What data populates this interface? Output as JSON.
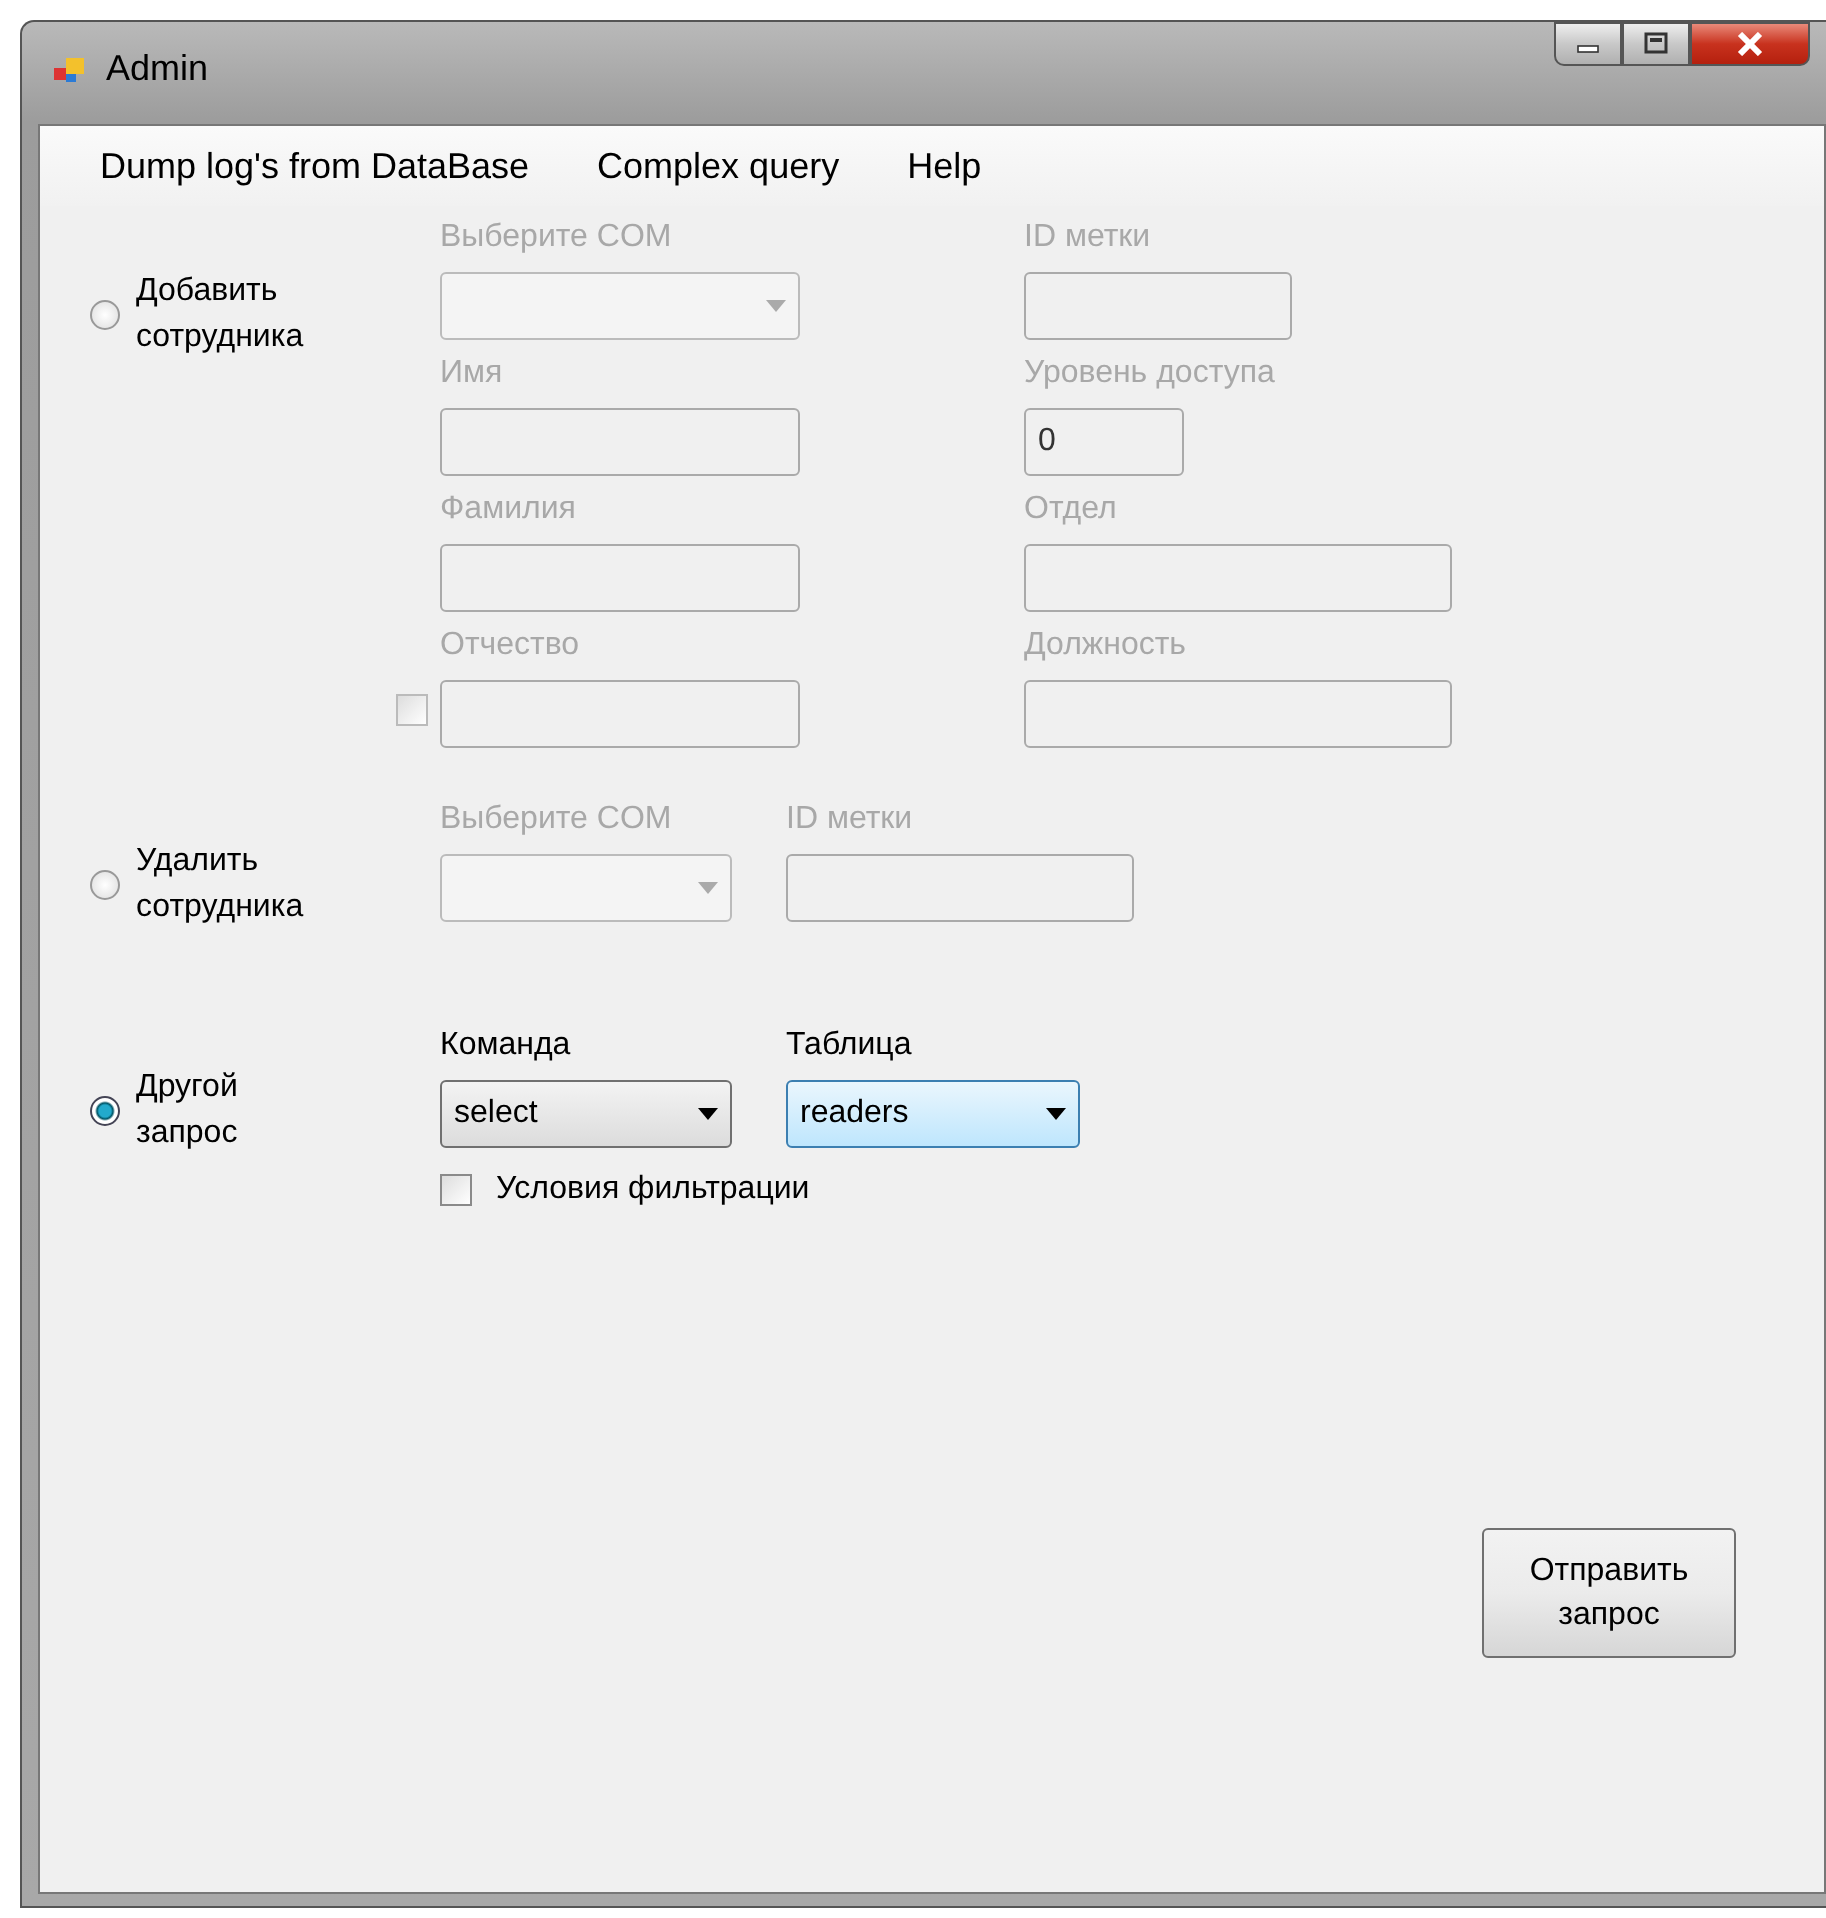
{
  "window": {
    "title": "Admin"
  },
  "menu": [
    {
      "label": "Dump log's from DataBase"
    },
    {
      "label": "Complex query"
    },
    {
      "label": "Help"
    }
  ],
  "sections": [
    {
      "kind": "add",
      "label": "Добавить сотрудника",
      "selected": false,
      "enabled": false,
      "checkbox": {
        "checked": false
      },
      "fields": [
        {
          "kind": "combo",
          "label": "Выберите COM"
        },
        {
          "kind": "text",
          "label": "ID метки"
        },
        {
          "kind": "text",
          "label": "Имя"
        },
        {
          "kind": "number",
          "label": "Уровень доступа",
          "value": "0"
        },
        {
          "kind": "text",
          "label": "Фамилия"
        },
        {
          "kind": "text",
          "label": "Отдел"
        },
        {
          "kind": "text",
          "label": "Отчество"
        },
        {
          "kind": "text",
          "label": "Должность"
        }
      ]
    },
    {
      "kind": "delete",
      "label": "Удалить сотрудника",
      "selected": false,
      "enabled": false,
      "fields": [
        {
          "kind": "combo",
          "label": "Выберите COM"
        },
        {
          "kind": "text",
          "label": "ID метки"
        }
      ]
    },
    {
      "kind": "query",
      "label": "Другой запрос",
      "selected": true,
      "enabled": true,
      "checkbox": {
        "label": "Условия фильтрации",
        "checked": false
      },
      "fields": [
        {
          "kind": "combo",
          "label": "Команда",
          "value": "select",
          "focused": false
        },
        {
          "kind": "combo",
          "label": "Таблица",
          "value": "readers",
          "focused": true
        }
      ]
    }
  ],
  "submit_button": "Отправить запрос"
}
